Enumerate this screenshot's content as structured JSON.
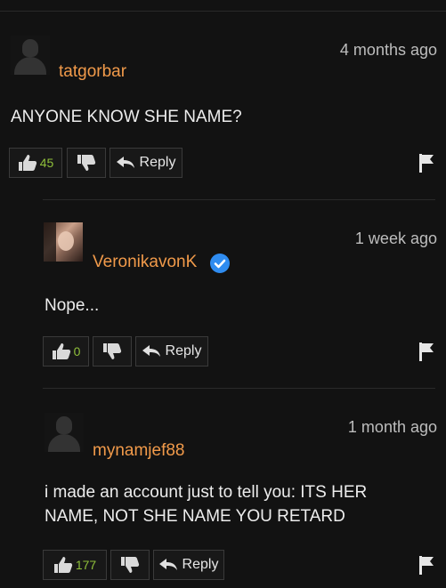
{
  "comments": [
    {
      "username": "tatgorbar",
      "timestamp": "4 months ago",
      "text": "ANYONE KNOW SHE NAME?",
      "likes": "45",
      "reply_label": "Reply",
      "verified": false
    },
    {
      "username": "VeronikavonK",
      "timestamp": "1 week ago",
      "text": "Nope...",
      "likes": "0",
      "reply_label": "Reply",
      "verified": true
    },
    {
      "username": "mynamjef88",
      "timestamp": "1 month ago",
      "text_line1": "i made an account just to tell you: ITS HER",
      "text_line2": "NAME, NOT SHE NAME YOU RETARD",
      "likes": "177",
      "reply_label": "Reply",
      "verified": false
    }
  ],
  "icons": {
    "like": "thumbs-up-icon",
    "dislike": "thumbs-down-icon",
    "reply": "reply-arrow-icon",
    "flag": "flag-icon",
    "verified": "verified-check-icon"
  },
  "colors": {
    "background": "#121212",
    "username": "#f19a4a",
    "like_count": "#8fbf3a",
    "verified": "#2f8cf0"
  }
}
